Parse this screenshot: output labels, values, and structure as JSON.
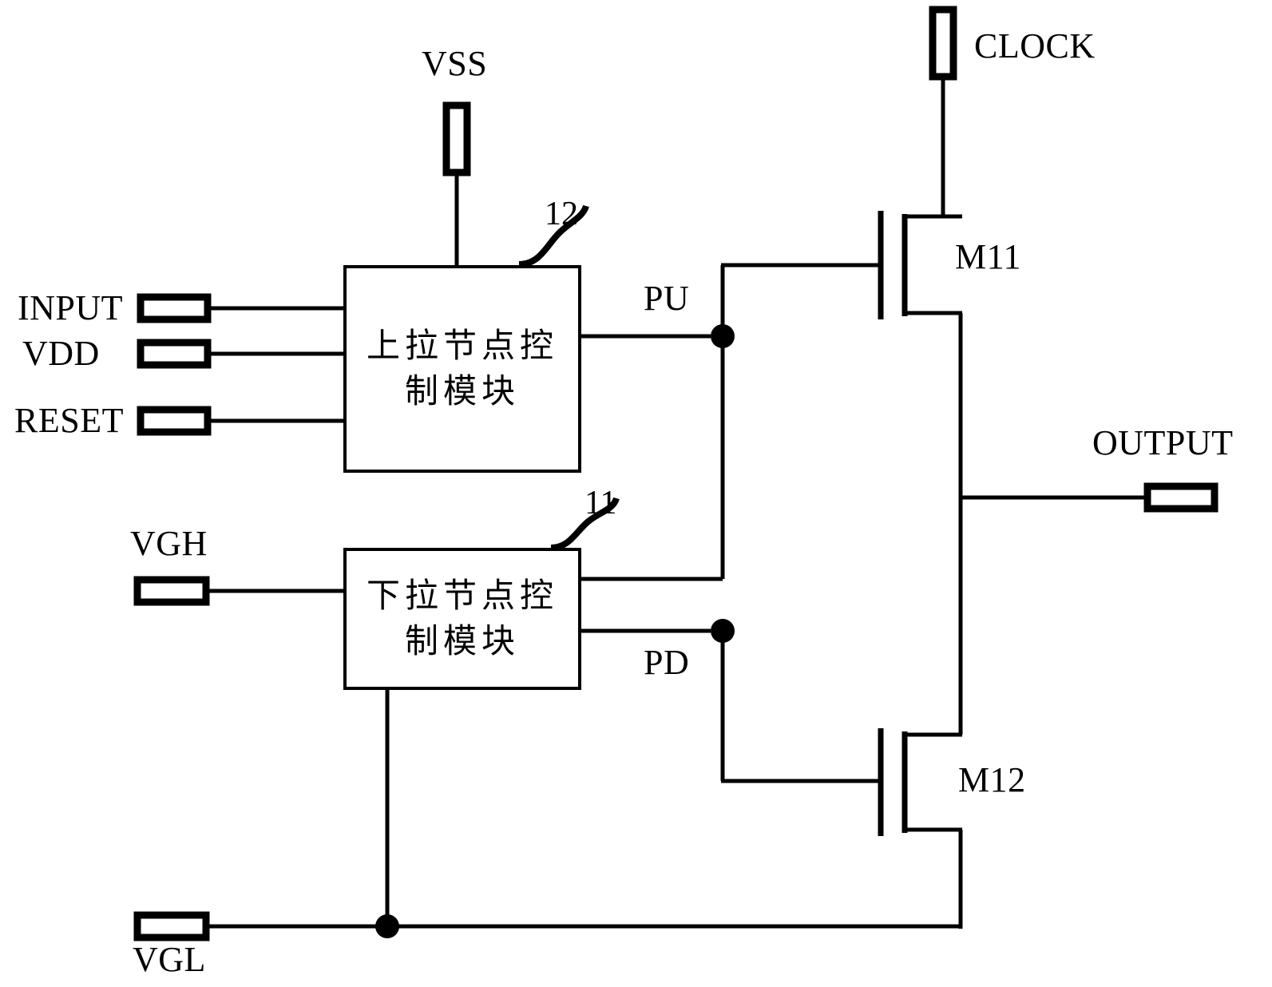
{
  "figure": {
    "type": "circuit-schematic",
    "title": "",
    "background_color": "#ffffff",
    "line_color": "#000000"
  },
  "modules": [
    {
      "id": "pull-up-control",
      "label": "上拉节点控\n制模块",
      "label_line1": "上拉节点控",
      "label_line2": "制模块",
      "reference_numeral": "12"
    },
    {
      "id": "pull-down-control",
      "label": "下拉节点控\n制模块",
      "label_line1": "下拉节点控",
      "label_line2": "制模块",
      "reference_numeral": "11"
    }
  ],
  "terminals": {
    "input": "INPUT",
    "vdd": "VDD",
    "reset": "RESET",
    "vss": "VSS",
    "vgh": "VGH",
    "vgl": "VGL",
    "clock": "CLOCK",
    "output": "OUTPUT"
  },
  "nodes": {
    "pull_up": "PU",
    "pull_down": "PD"
  },
  "transistors": {
    "m11": "M11",
    "m12": "M12"
  }
}
